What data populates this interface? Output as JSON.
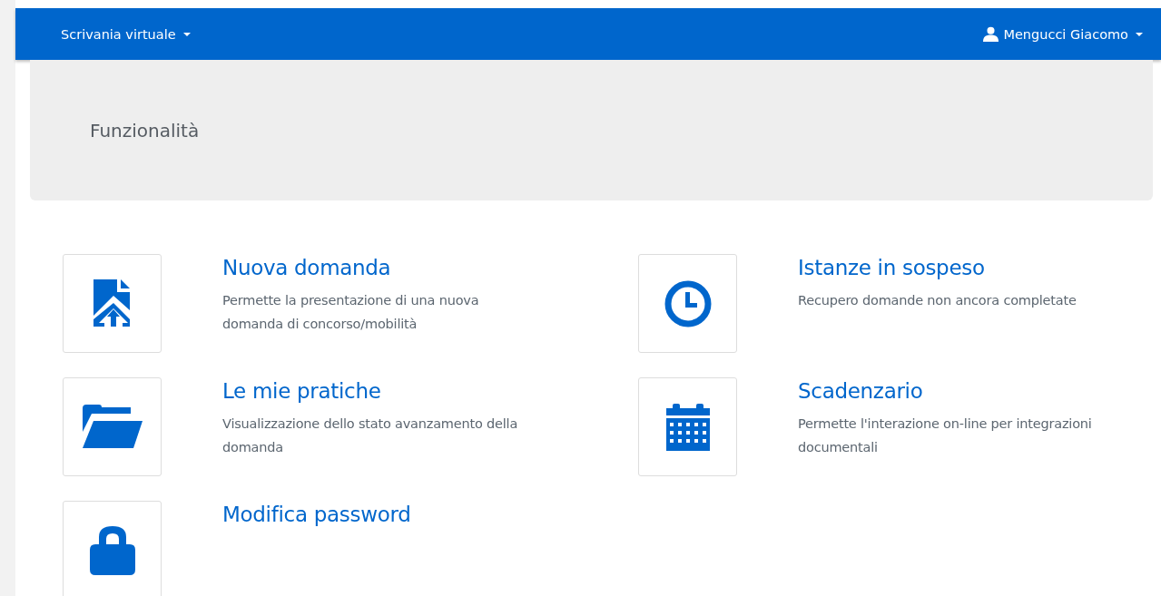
{
  "navbar": {
    "brand": "Scrivania virtuale",
    "user": "Mengucci Giacomo"
  },
  "header": {
    "title": "Funzionalità"
  },
  "features": [
    {
      "kind": "upload",
      "title": "Nuova domanda",
      "description": "Permette la presentazione di una nuova domanda di concorso/mobilità"
    },
    {
      "kind": "clock",
      "title": "Istanze in sospeso",
      "description": "Recupero domande non ancora completate"
    },
    {
      "kind": "folder",
      "title": "Le mie pratiche",
      "description": "Visualizzazione dello stato avanzamento della domanda"
    },
    {
      "kind": "calendar",
      "title": "Scadenzario",
      "description": "Permette l'interazione on-line per integrazioni documentali"
    },
    {
      "kind": "lock",
      "title": "Modifica password"
    }
  ]
}
